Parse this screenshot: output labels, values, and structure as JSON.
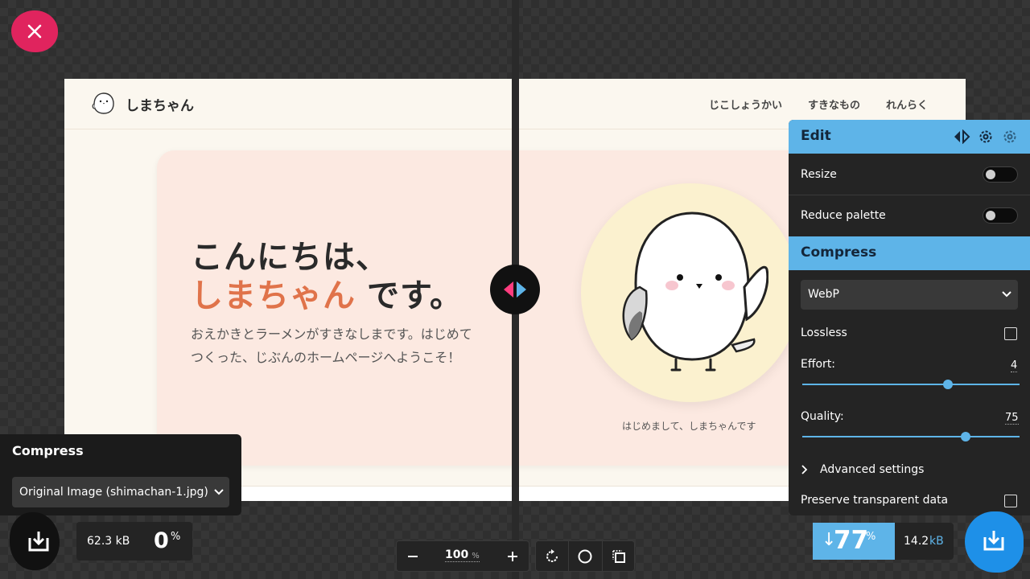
{
  "site": {
    "brand": "しまちゃん",
    "nav": [
      "じこしょうかい",
      "すきなもの",
      "れんらく"
    ],
    "hero_line1": "こんにちは、",
    "hero_name": "しまちゃん",
    "hero_suffix": "です。",
    "hero_desc": "おえかきとラーメンがすきなしまです。はじめてつくった、じぶんのホームページへようこそ！",
    "hero_caption": "はじめまして、しまちゃんです"
  },
  "edit_panel": {
    "title": "Edit",
    "resize_label": "Resize",
    "resize_on": false,
    "reduce_palette_label": "Reduce palette",
    "reduce_palette_on": false,
    "compress_title": "Compress",
    "format_value": "WebP",
    "lossless_label": "Lossless",
    "lossless_checked": false,
    "effort_label": "Effort:",
    "effort_value": "4",
    "effort_fraction": 0.67,
    "quality_label": "Quality:",
    "quality_value": "75",
    "quality_fraction": 0.75,
    "advanced_label": "Advanced settings",
    "preserve_label": "Preserve transparent data",
    "preserve_checked": false
  },
  "source_panel": {
    "title": "Compress",
    "select_value": "Original Image (shimachan-1.jpg)"
  },
  "bottom": {
    "original_size": "62.3 kB",
    "original_percent": "0",
    "percent_sign": "%",
    "zoom_value": "100",
    "zoom_unit": "%",
    "savings_arrow": "↓",
    "savings_value": "77",
    "savings_unit": "%",
    "compressed_size": "14.2",
    "compressed_unit": "kB"
  },
  "colors": {
    "accent": "#5eb4e8",
    "close": "#e0245e",
    "download_primary": "#1e90e8",
    "hero_name": "#e0734a",
    "canvas_bg": "#fbf7ef",
    "card_bg": "#fce9e1"
  },
  "icons": {
    "close": "close-icon",
    "divider": "split-arrows-icon",
    "download": "download-icon",
    "minus": "minus-icon",
    "plus": "plus-icon",
    "rotate": "rotate-icon",
    "circle": "background-toggle-icon",
    "crop": "crop-icon",
    "settings": "gear-icon",
    "chevron": "chevron-down-icon"
  }
}
